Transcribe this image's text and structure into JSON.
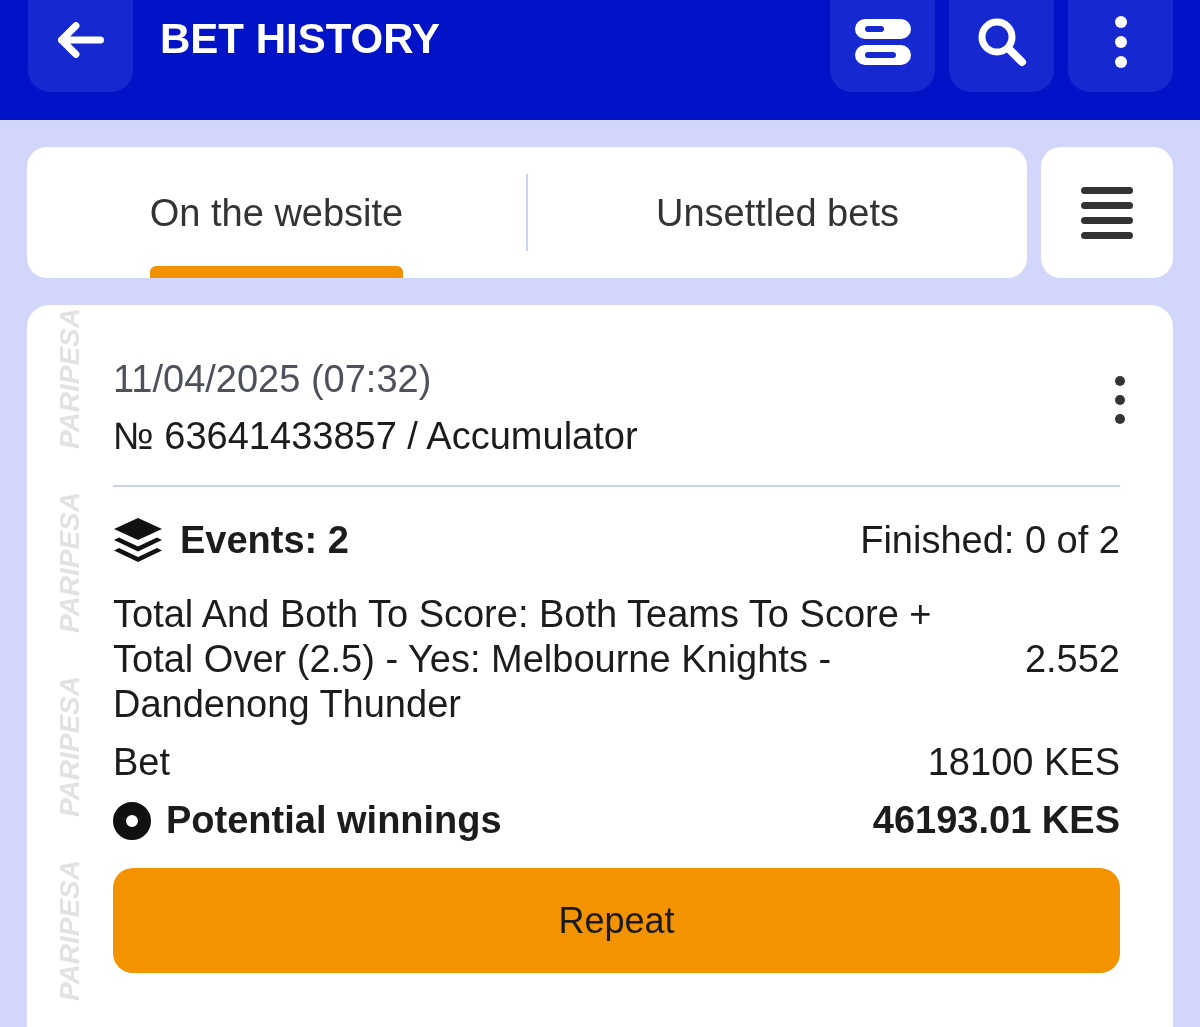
{
  "header": {
    "title": "BET HISTORY"
  },
  "tabs": [
    {
      "label": "On the website",
      "selected": true
    },
    {
      "label": "Unsettled bets",
      "selected": false
    }
  ],
  "bet": {
    "side_brand": [
      "PARIPESA",
      "PARIPESA",
      "PARIPESA",
      "PARIPESA"
    ],
    "date": "11/04/2025 (07:32)",
    "number": "№ 63641433857 / Accumulator",
    "events": "Events: 2",
    "finished": "Finished: 0 of 2",
    "selections": [
      {
        "description": "Total And Both To Score: Both Teams To Score + Total Over (2.5) - Yes: Melbourne Knights - Dandenong Thunder",
        "odds": "2.552"
      }
    ],
    "rows": [
      {
        "kind": "plain",
        "label": "Bet",
        "value": "18100 KES"
      },
      {
        "kind": "highlight",
        "label": "Potential winnings",
        "value": "46193.01 KES"
      }
    ],
    "action": "Repeat"
  }
}
